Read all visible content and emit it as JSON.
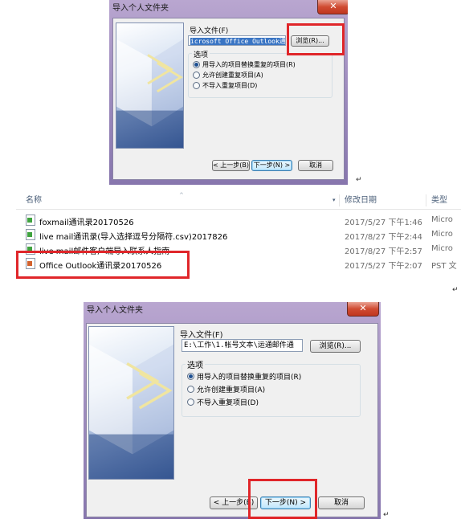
{
  "dialog_top": {
    "title": "导入个人文件夹",
    "close_symbol": "✕",
    "import_file_label": "导入文件(F)",
    "path_value": "icrosoft Office Outlook通.pst",
    "browse_label": "浏览(R)...",
    "options_label": "选项",
    "options": [
      {
        "label": "用导入的项目替换重复的项目(R)",
        "selected": true
      },
      {
        "label": "允许创建重复项目(A)",
        "selected": false
      },
      {
        "label": "不导入重复项目(D)",
        "selected": false
      }
    ],
    "back_label": "< 上一步(B)",
    "next_label": "下一步(N) >",
    "cancel_label": "取消"
  },
  "file_list": {
    "columns": {
      "name": "名称",
      "modified": "修改日期",
      "type": "类型"
    },
    "rows": [
      {
        "name": "foxmail通讯录20170526",
        "modified": "2017/5/27 下午1:46",
        "type": "Micro",
        "icon": "csv-file-icon"
      },
      {
        "name": "live mail通讯录(导入选择逗号分隔符.csv)2017826",
        "modified": "2017/8/27 下午2:44",
        "type": "Micro",
        "icon": "csv-file-icon"
      },
      {
        "name": "live mail邮件客户端导入联系人指南",
        "modified": "2017/8/27 下午2:57",
        "type": "Micro",
        "icon": "doc-file-icon"
      },
      {
        "name": "Office Outlook通讯录20170526",
        "modified": "2017/5/27 下午2:07",
        "type": "PST 文",
        "icon": "pst-file-icon"
      }
    ]
  },
  "dialog_bottom": {
    "title": "导入个人文件夹",
    "close_symbol": "✕",
    "import_file_label": "导入文件(F)",
    "path_value": "E:\\工作\\1.帐号文本\\运通邮件通",
    "browse_label": "浏览(R)...",
    "options_label": "选项",
    "options": [
      {
        "label": "用导入的项目替换重复的项目(R)",
        "selected": true
      },
      {
        "label": "允许创建重复项目(A)",
        "selected": false
      },
      {
        "label": "不导入重复项目(D)",
        "selected": false
      }
    ],
    "back_label": "< 上一步(B)",
    "next_label": "下一步(N) >",
    "cancel_label": "取消"
  },
  "paragraph_mark": "↵",
  "colors": {
    "highlight_red": "#e0262a",
    "window_frame": "#9d8bbd",
    "selection_blue": "#3a75c4"
  }
}
